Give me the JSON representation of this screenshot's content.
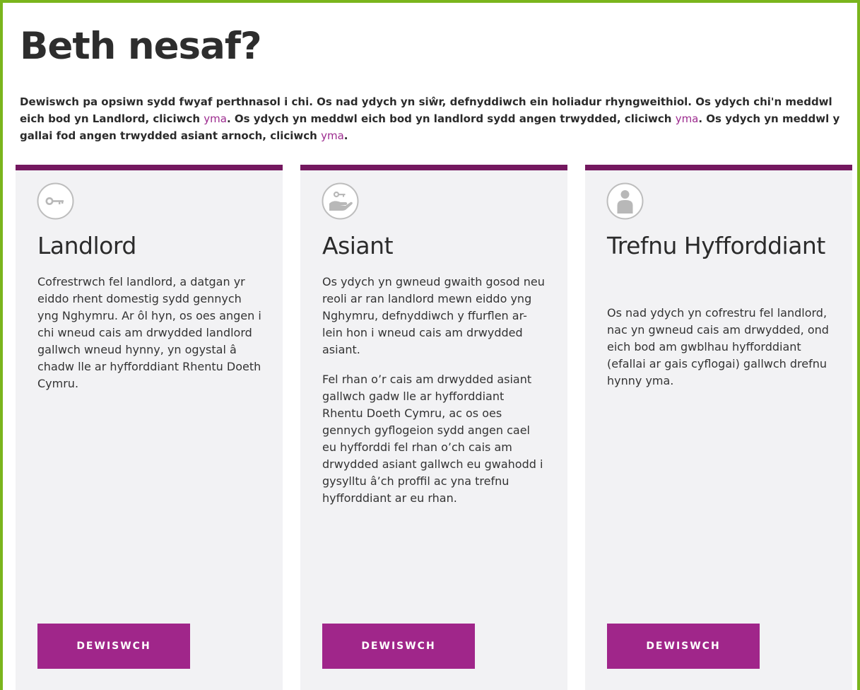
{
  "page": {
    "heading": "Beth nesaf?",
    "intro": {
      "part1": "Dewiswch pa opsiwn sydd fwyaf perthnasol i chi. Os nad ydych yn siŵr, defnyddiwch ein holiadur rhyngweithiol. Os ydych chi'n meddwl eich bod yn Landlord, cliciwch ",
      "link1": "yma",
      "part2": ". Os ydych yn meddwl eich bod yn landlord sydd angen trwydded, cliciwch ",
      "link2": "yma",
      "part3": ". Os ydych yn meddwl y gallai fod angen trwydded asiant arnoch, cliciwch ",
      "link3": "yma",
      "part4": "."
    }
  },
  "colors": {
    "frame_border": "#7ab51d",
    "card_top_border": "#74185f",
    "card_background": "#f2f2f4",
    "button": "#a0268a",
    "link": "#9c2a8e",
    "icon": "#b8b8b8"
  },
  "cards": [
    {
      "icon": "key-icon",
      "title": "Landlord",
      "paragraphs": [
        "Cofrestrwch fel landlord, a datgan yr eiddo rhent domestig sydd gennych yng Nghymru. Ar ôl hyn, os oes angen i chi wneud cais am drwydded landlord gallwch wneud hynny, yn ogystal â chadw lle ar hyfforddiant Rhentu Doeth Cymru."
      ],
      "button": "DEWISWCH"
    },
    {
      "icon": "hand-key-icon",
      "title": "Asiant",
      "paragraphs": [
        "Os ydych yn gwneud gwaith gosod neu reoli ar ran landlord mewn eiddo yng Nghymru, defnyddiwch y ffurflen ar-lein hon i wneud cais am drwydded asiant.",
        "Fel rhan o’r cais am drwydded asiant gallwch gadw lle ar hyfforddiant Rhentu Doeth Cymru, ac os oes gennych gyflogeion sydd angen cael eu hyfforddi fel rhan o’ch cais am drwydded asiant gallwch eu gwahodd i gysylltu â’ch proffil ac yna trefnu hyfforddiant ar eu rhan."
      ],
      "button": "DEWISWCH"
    },
    {
      "icon": "person-icon",
      "title": "Trefnu Hyfforddiant",
      "paragraphs": [
        "Os nad ydych yn cofrestru fel landlord, nac yn gwneud cais am drwydded, ond eich bod am gwblhau hyfforddiant (efallai ar gais cyflogai) gallwch drefnu hynny yma."
      ],
      "button": "DEWISWCH"
    }
  ]
}
